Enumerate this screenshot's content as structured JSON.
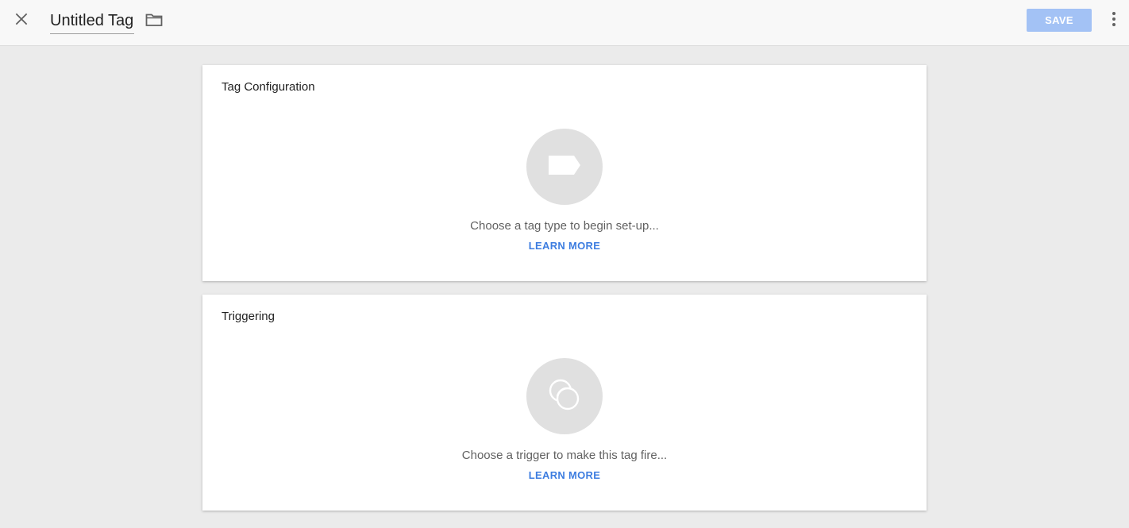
{
  "header": {
    "close_icon": "close-icon",
    "title": "Untitled Tag",
    "folder_icon": "folder-icon",
    "save_label": "SAVE",
    "more_icon": "more-vert-icon",
    "save_color": "#a3c2f5"
  },
  "tag_configuration": {
    "title": "Tag Configuration",
    "icon": "tag-icon",
    "prompt": "Choose a tag type to begin set-up...",
    "learn_more": "LEARN MORE"
  },
  "triggering": {
    "title": "Triggering",
    "icon": "trigger-icon",
    "prompt": "Choose a trigger to make this tag fire...",
    "learn_more": "LEARN MORE"
  },
  "colors": {
    "accent": "#3d7de0",
    "background": "#ebebeb",
    "card": "#ffffff"
  }
}
